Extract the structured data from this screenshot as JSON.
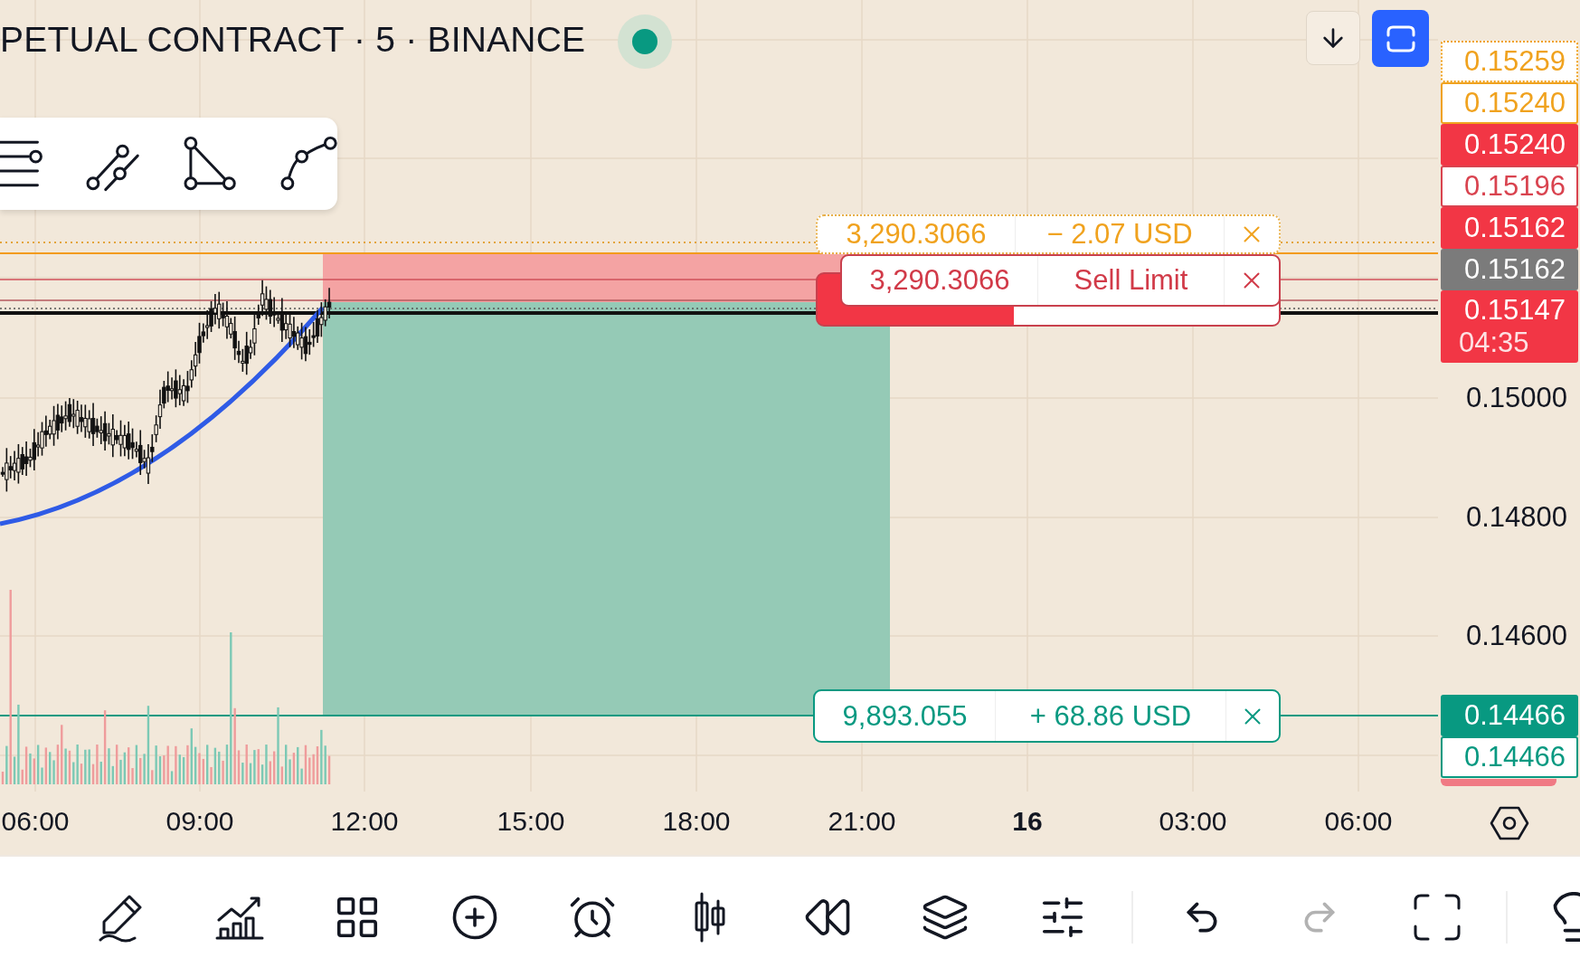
{
  "header": {
    "title": "PETUAL CONTRACT · 5 · BINANCE"
  },
  "orders": [
    {
      "kind": "position",
      "quantity": "3,290.3066",
      "result": "− 2.07 USD"
    },
    {
      "kind": "limit",
      "quantity": "3,290.3066",
      "result": "Sell Limit"
    },
    {
      "kind": "target",
      "quantity": "9,893.055",
      "result": "+ 68.86 USD"
    }
  ],
  "price_axis": {
    "ticks": [
      "0.15000",
      "0.14800",
      "0.14600"
    ],
    "markers": [
      {
        "price": "0.15259",
        "kind": "position",
        "color": "#f0a21e"
      },
      {
        "price": "0.15240",
        "kind": "order",
        "color": "#f0a21e"
      },
      {
        "price": "0.15240",
        "kind": "level",
        "color": "#f23645"
      },
      {
        "price": "0.15196",
        "kind": "order",
        "color": "#d9434f"
      },
      {
        "price": "0.15162",
        "kind": "level",
        "color": "#f23645"
      },
      {
        "price": "0.15162",
        "kind": "level",
        "color": "#7b7b7b"
      },
      {
        "price": "0.15147",
        "kind": "level",
        "color": "#f23645",
        "countdown": "04:35"
      }
    ],
    "lower_markers": [
      {
        "price": "0.14466",
        "kind": "level",
        "color": "#089981"
      },
      {
        "price": "0.14466",
        "kind": "order",
        "color": "#089981"
      }
    ]
  },
  "time_axis": [
    {
      "label": "06:00",
      "emphasized": false
    },
    {
      "label": "09:00",
      "emphasized": false
    },
    {
      "label": "12:00",
      "emphasized": false
    },
    {
      "label": "15:00",
      "emphasized": false
    },
    {
      "label": "18:00",
      "emphasized": false
    },
    {
      "label": "21:00",
      "emphasized": false
    },
    {
      "label": "16",
      "emphasized": true
    },
    {
      "label": "03:00",
      "emphasized": false
    },
    {
      "label": "06:00",
      "emphasized": false
    }
  ],
  "toolbar": [
    {
      "kind": "draw",
      "disabled": false
    },
    {
      "kind": "indicators",
      "disabled": false
    },
    {
      "kind": "templates",
      "disabled": false
    },
    {
      "kind": "add",
      "disabled": false
    },
    {
      "kind": "alert",
      "disabled": false
    },
    {
      "kind": "chart_type",
      "disabled": false
    },
    {
      "kind": "replay",
      "disabled": false
    },
    {
      "kind": "layers",
      "disabled": false
    },
    {
      "kind": "settings",
      "disabled": false
    },
    {
      "kind": "undo",
      "disabled": false
    },
    {
      "kind": "redo",
      "disabled": true
    },
    {
      "kind": "fullscreen",
      "disabled": false
    },
    {
      "kind": "idea",
      "disabled": false
    }
  ]
}
